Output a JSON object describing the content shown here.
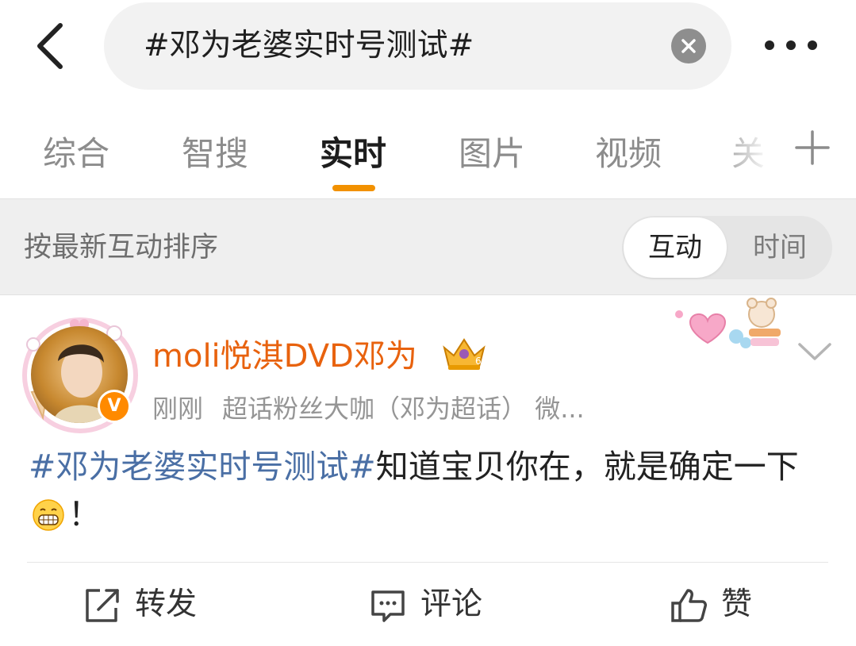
{
  "search": {
    "query": "#邓为老婆实时号测试#"
  },
  "tabs": [
    {
      "label": "综合"
    },
    {
      "label": "智搜"
    },
    {
      "label": "实时"
    },
    {
      "label": "图片"
    },
    {
      "label": "视频"
    },
    {
      "label": "关"
    }
  ],
  "active_tab": "实时",
  "sort": {
    "label": "按最新互动排序",
    "option_interaction": "互动",
    "option_time": "时间",
    "selected": "互动"
  },
  "post": {
    "username": "moli悦淇DVD邓为",
    "verified_badge": "V",
    "time": "刚刚",
    "source": "超话粉丝大咖（邓为超话） 微...",
    "topic": "#邓为老婆实时号测试#",
    "text_part1": "知道宝贝你在，就是确定一下",
    "text_part2": "！"
  },
  "actions": {
    "repost": "转发",
    "comment": "评论",
    "like": "赞"
  },
  "colors": {
    "accent": "#f29100",
    "username": "#e8620e",
    "topic": "#4a6fa5"
  }
}
